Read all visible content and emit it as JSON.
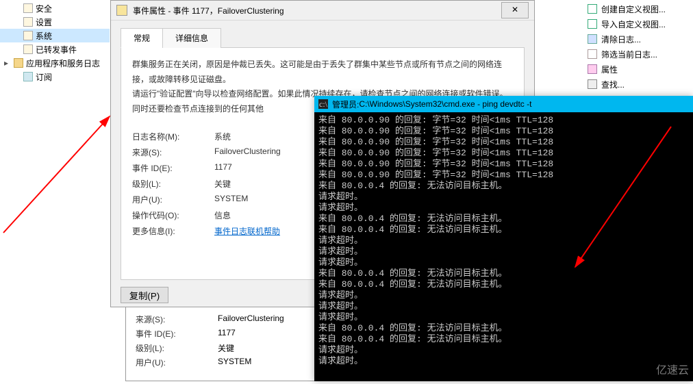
{
  "tree": {
    "items": [
      {
        "label": "安全",
        "icon": "log"
      },
      {
        "label": "设置",
        "icon": "log"
      },
      {
        "label": "系统",
        "icon": "log",
        "selected": true
      },
      {
        "label": "已转发事件",
        "icon": "log"
      },
      {
        "label": "应用程序和服务日志",
        "icon": "folder",
        "expandable": true
      },
      {
        "label": "订阅",
        "icon": "sub"
      }
    ]
  },
  "dialog": {
    "title": "事件属性 - 事件 1177，FailoverClustering",
    "tabs": [
      "常规",
      "详细信息"
    ],
    "description_line1": "群集服务正在关闭，原因是仲裁已丢失。这可能是由于丢失了群集中某些节点或所有节点之间的网络连接，或故障转移见证磁盘。",
    "description_line2": "请运行\"验证配置\"向导以检查网络配置。如果此情况持续存在，请检查节点之间的网络连接或软件错误。同时还要检查节点连接到的任何其他",
    "fields": {
      "log_name_label": "日志名称(M):",
      "log_name": "系统",
      "source_label": "来源(S):",
      "source": "FailoverClustering",
      "event_id_label": "事件 ID(E):",
      "event_id": "1177",
      "level_label": "级别(L):",
      "level": "关键",
      "user_label": "用户(U):",
      "user": "SYSTEM",
      "opcode_label": "操作代码(O):",
      "opcode": "信息",
      "more_info_label": "更多信息(I):",
      "more_info": "事件日志联机帮助"
    },
    "copy_button": "复制(P)"
  },
  "bg_panel": {
    "source_label": "来源(S):",
    "source": "FailoverClustering",
    "event_id_label": "事件 ID(E):",
    "event_id": "1177",
    "level_label": "级别(L):",
    "level": "关键",
    "user_label": "用户(U):",
    "user": "SYSTEM"
  },
  "actions": {
    "items": [
      "创建自定义视图...",
      "导入自定义视图...",
      "清除日志...",
      "筛选当前日志...",
      "属性",
      "查找..."
    ]
  },
  "cmd": {
    "title_prefix": "管理员: ",
    "title_path": "C:\\Windows\\System32\\cmd.exe - ping  devdtc -t",
    "lines": [
      "来自 80.0.0.90 的回复: 字节=32 时间<1ms TTL=128",
      "来自 80.0.0.90 的回复: 字节=32 时间<1ms TTL=128",
      "来自 80.0.0.90 的回复: 字节=32 时间<1ms TTL=128",
      "来自 80.0.0.90 的回复: 字节=32 时间<1ms TTL=128",
      "来自 80.0.0.90 的回复: 字节=32 时间<1ms TTL=128",
      "来自 80.0.0.90 的回复: 字节=32 时间<1ms TTL=128",
      "来自 80.0.0.4 的回复: 无法访问目标主机。",
      "请求超时。",
      "请求超时。",
      "来自 80.0.0.4 的回复: 无法访问目标主机。",
      "来自 80.0.0.4 的回复: 无法访问目标主机。",
      "请求超时。",
      "请求超时。",
      "请求超时。",
      "来自 80.0.0.4 的回复: 无法访问目标主机。",
      "来自 80.0.0.4 的回复: 无法访问目标主机。",
      "请求超时。",
      "请求超时。",
      "请求超时。",
      "来自 80.0.0.4 的回复: 无法访问目标主机。",
      "来自 80.0.0.4 的回复: 无法访问目标主机。",
      "请求超时。",
      "请求超时。"
    ]
  },
  "watermark": "亿速云"
}
